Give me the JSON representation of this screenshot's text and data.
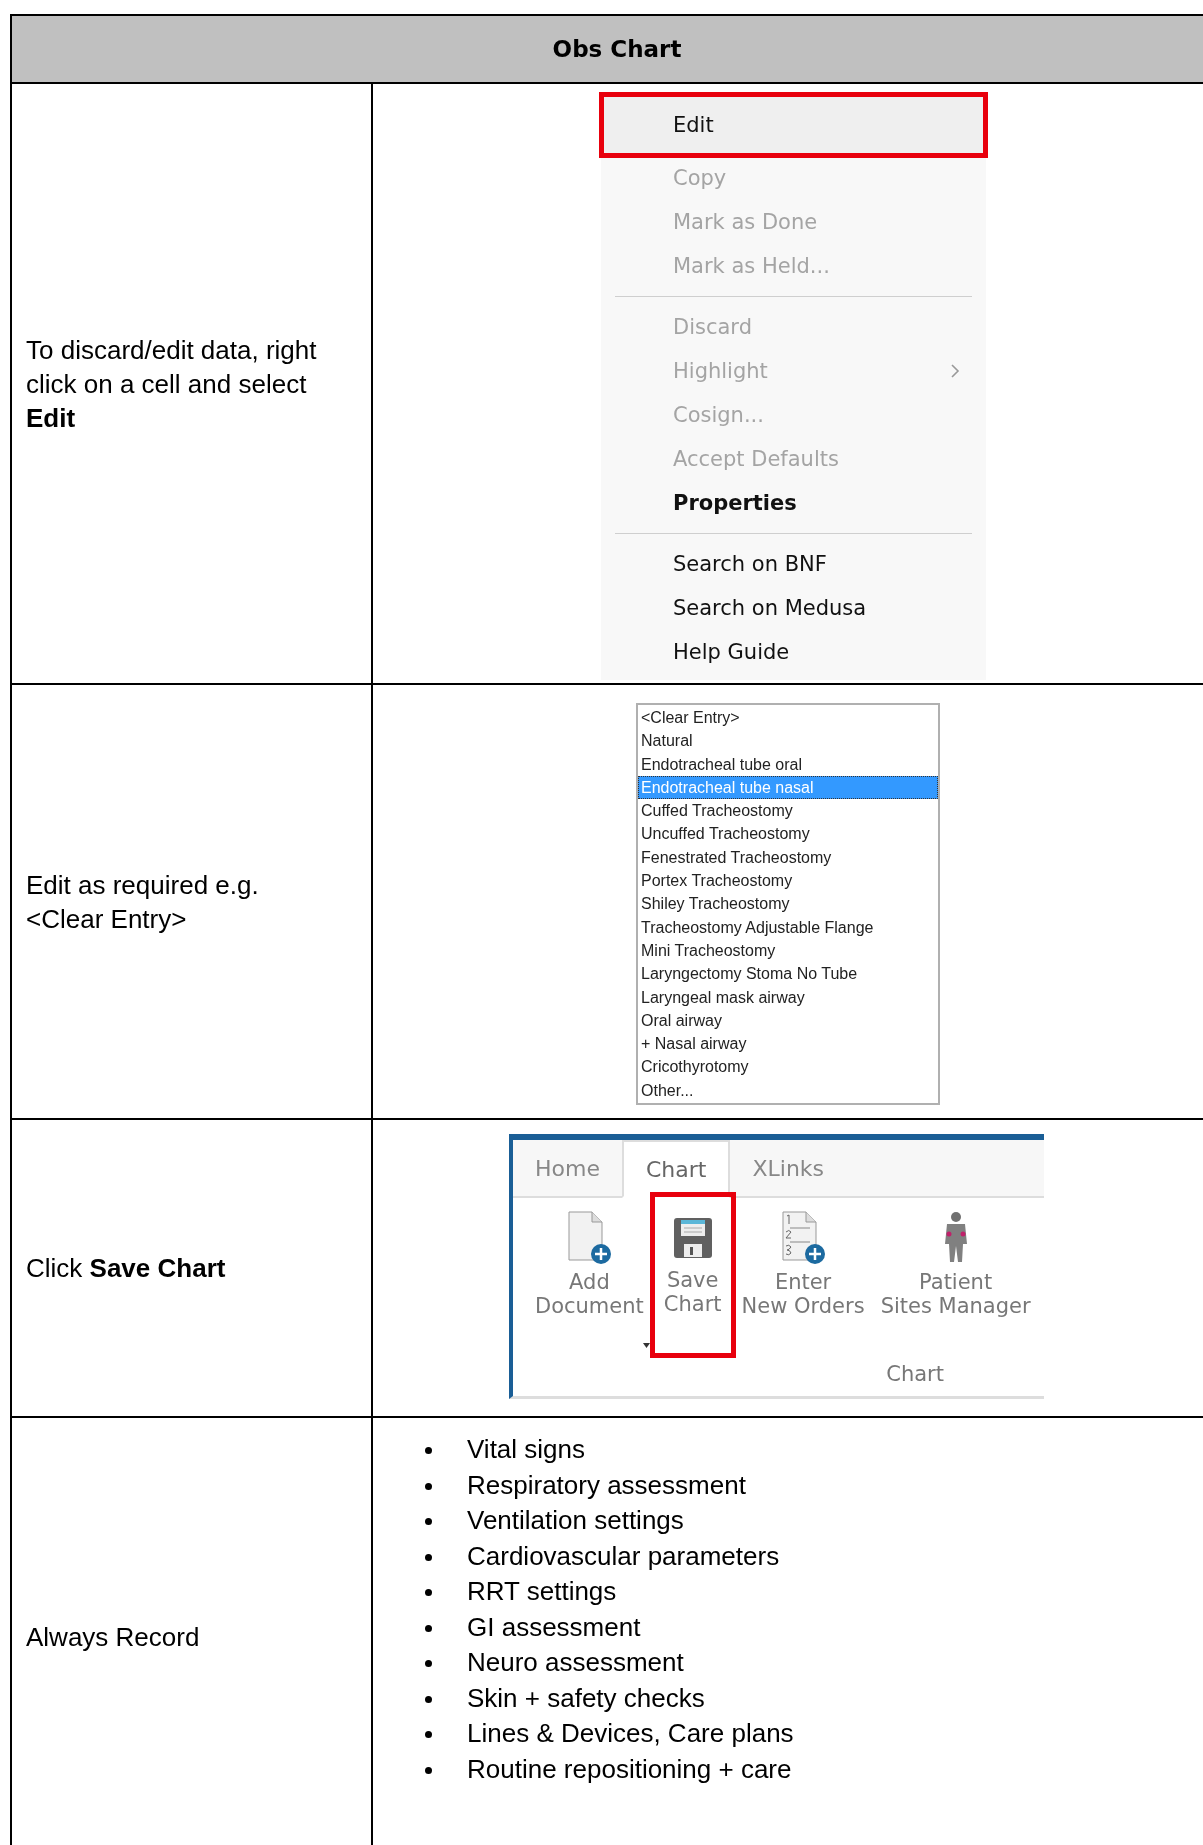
{
  "header": "Obs Chart",
  "rows": [
    {
      "kind": "menu",
      "instruction": "To discard/edit data, right click on a cell and select **Edit**",
      "menu": [
        {
          "kind": "item",
          "label": "Edit",
          "disabled": false,
          "bold": false,
          "highlighted": true,
          "submenu": false
        },
        {
          "kind": "item",
          "label": "Copy",
          "disabled": true,
          "bold": false,
          "highlighted": false,
          "submenu": false
        },
        {
          "kind": "item",
          "label": "Mark as Done",
          "disabled": true,
          "bold": false,
          "highlighted": false,
          "submenu": false
        },
        {
          "kind": "item",
          "label": "Mark as Held...",
          "disabled": true,
          "bold": false,
          "highlighted": false,
          "submenu": false
        },
        {
          "kind": "separator"
        },
        {
          "kind": "item",
          "label": "Discard",
          "disabled": true,
          "bold": false,
          "highlighted": false,
          "submenu": false
        },
        {
          "kind": "item",
          "label": "Highlight",
          "disabled": true,
          "bold": false,
          "highlighted": false,
          "submenu": true
        },
        {
          "kind": "item",
          "label": "Cosign...",
          "disabled": true,
          "bold": false,
          "highlighted": false,
          "submenu": false
        },
        {
          "kind": "item",
          "label": "Accept Defaults",
          "disabled": true,
          "bold": false,
          "highlighted": false,
          "submenu": false
        },
        {
          "kind": "item",
          "label": "Properties",
          "disabled": false,
          "bold": true,
          "highlighted": false,
          "submenu": false
        },
        {
          "kind": "separator"
        },
        {
          "kind": "item",
          "label": "Search on BNF",
          "disabled": false,
          "bold": false,
          "highlighted": false,
          "submenu": false
        },
        {
          "kind": "item",
          "label": "Search on Medusa",
          "disabled": false,
          "bold": false,
          "highlighted": false,
          "submenu": false
        },
        {
          "kind": "item",
          "label": "Help Guide",
          "disabled": false,
          "bold": false,
          "highlighted": false,
          "submenu": false
        }
      ]
    },
    {
      "kind": "list",
      "instruction": "Edit as required e.g. <Clear Entry>",
      "options": [
        {
          "label": "<Clear Entry>",
          "selected": false
        },
        {
          "label": "Natural",
          "selected": false
        },
        {
          "label": "Endotracheal tube oral",
          "selected": false
        },
        {
          "label": "Endotracheal tube nasal",
          "selected": true
        },
        {
          "label": "Cuffed Tracheostomy",
          "selected": false
        },
        {
          "label": "Uncuffed Tracheostomy",
          "selected": false
        },
        {
          "label": "Fenestrated Tracheostomy",
          "selected": false
        },
        {
          "label": "Portex Tracheostomy",
          "selected": false
        },
        {
          "label": "Shiley Tracheostomy",
          "selected": false
        },
        {
          "label": "Tracheostomy Adjustable Flange",
          "selected": false
        },
        {
          "label": "Mini Tracheostomy",
          "selected": false
        },
        {
          "label": "Laryngectomy Stoma No Tube",
          "selected": false
        },
        {
          "label": "Laryngeal mask airway",
          "selected": false
        },
        {
          "label": "Oral airway",
          "selected": false
        },
        {
          "label": "+ Nasal airway",
          "selected": false
        },
        {
          "label": "Cricothyrotomy",
          "selected": false
        },
        {
          "label": "Other...",
          "selected": false
        }
      ]
    },
    {
      "kind": "ribbon",
      "instruction": "Click **Save Chart**",
      "tabs": [
        {
          "label": "Home",
          "selected": false
        },
        {
          "label": "Chart",
          "selected": true
        },
        {
          "label": "XLinks",
          "selected": false
        }
      ],
      "buttons": [
        {
          "kind": "add-document",
          "lines": [
            "Add",
            "Document"
          ],
          "dropdown": true,
          "highlighted": false
        },
        {
          "kind": "save",
          "lines": [
            "Save",
            "Chart"
          ],
          "dropdown": false,
          "highlighted": true
        },
        {
          "kind": "orders",
          "lines": [
            "Enter",
            "New Orders"
          ],
          "dropdown": false,
          "highlighted": false
        },
        {
          "kind": "patient",
          "lines": [
            "Patient",
            "Sites Manager"
          ],
          "dropdown": false,
          "highlighted": false
        }
      ],
      "group_label": "Chart"
    },
    {
      "kind": "bullets",
      "instruction": "Always Record",
      "bullets": [
        "Vital signs",
        "Respiratory assessment",
        "Ventilation settings",
        "Cardiovascular parameters",
        "RRT settings",
        "GI assessment",
        "Neuro assessment",
        "Skin + safety checks",
        "Lines & Devices, Care plans",
        "Routine repositioning + care"
      ]
    }
  ]
}
